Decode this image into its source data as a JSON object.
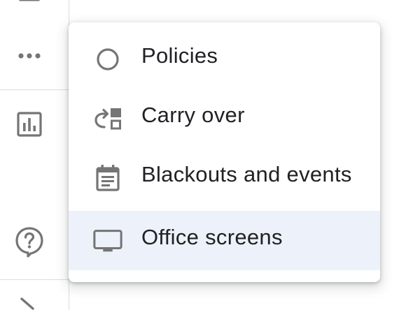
{
  "colors": {
    "icon_gray": "#757575",
    "text": "#202124",
    "selected_bg": "#edf2fa",
    "divider": "#dadce0"
  },
  "rail": {
    "items": [
      {
        "icon": "top-partial-icon"
      },
      {
        "icon": "more-horiz-icon"
      },
      {
        "icon": "insert-chart-icon"
      },
      {
        "icon": "help-outline-icon"
      },
      {
        "icon": "chevron-icon"
      }
    ]
  },
  "menu": {
    "items": [
      {
        "label": "Policies",
        "icon": "circle-outline-icon",
        "selected": false
      },
      {
        "label": "Carry over",
        "icon": "carry-over-icon",
        "selected": false
      },
      {
        "label": "Blackouts and events",
        "icon": "event-note-icon",
        "selected": false
      },
      {
        "label": "Office screens",
        "icon": "desktop-windows-icon",
        "selected": true
      }
    ]
  }
}
